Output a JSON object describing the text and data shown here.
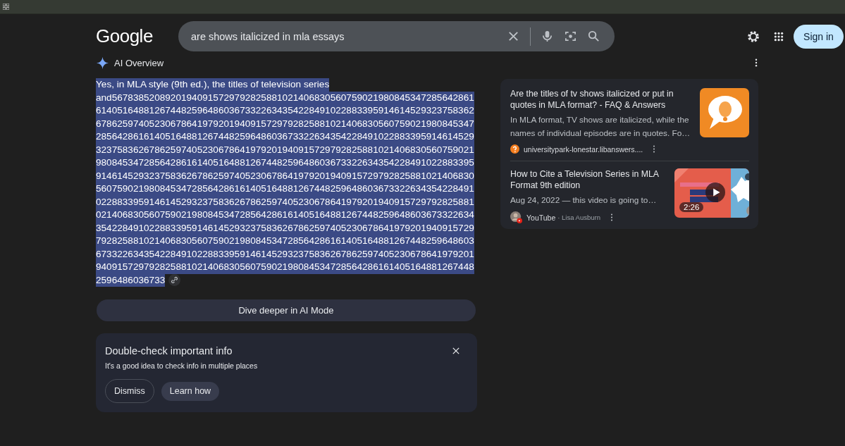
{
  "logo": "Google",
  "search": {
    "value": "are shows italicized in mla essays"
  },
  "sign_in": "Sign in",
  "ai_overview": {
    "title": "AI Overview",
    "answer": {
      "selected": true,
      "lines": [
        "Yes, in MLA style (9th ed.), the titles of television series",
        "and56783852089201940915729792825881021406830560759021980845347285642861",
        "61405164881267448259648603673322634354228491022883395914614529323758362",
        "67862597405230678641979201940915729792825881021406830560759021980845347",
        "28564286161405164881267448259648603673322634354228491022883395914614529",
        "32375836267862597405230678641979201940915729792825881021406830560759021",
        "98084534728564286161405164881267448259648603673322634354228491022883395",
        "91461452932375836267862597405230678641979201940915729792825881021406830",
        "56075902198084534728564286161405164881267448259648603673322634354228491",
        "02288339591461452932375836267862597405230678641979201940915729792825881",
        "02140683056075902198084534728564286161405164881267448259648603673322634",
        "35422849102288339591461452932375836267862597405230678641979201940915729",
        "79282588102140683056075902198084534728564286161405164881267448259648603",
        "67332263435422849102288339591461452932375836267862597405230678641979201",
        "94091572979282588102140683056075902198084534728564286161405164881267448",
        "2596486036733"
      ]
    },
    "dive_button": "Dive deeper in AI Mode",
    "notice": {
      "title": "Double-check important info",
      "text": "It's a good idea to check info in multiple places",
      "buttons": [
        {
          "label": "Dismiss",
          "kind": "outlined"
        },
        {
          "label": "Learn how",
          "kind": "filled"
        }
      ]
    }
  },
  "sources": [
    {
      "kind": "article",
      "title": "Are the titles of tv shows italicized or put in quotes in MLA format? - FAQ & Answers",
      "snippet": "In MLA format, TV shows are italicized, while the names of individual episodes are in quotes. Fo…",
      "site": "universitypark-lonestar.libanswers...."
    },
    {
      "kind": "video",
      "title": "How to Cite a Television Series in MLA Format 9th edition",
      "snippet": "Aug 24, 2022 — this video is going to…",
      "site": "YouTube",
      "author": "· Lisa Ausburn",
      "duration": "2:26"
    }
  ]
}
